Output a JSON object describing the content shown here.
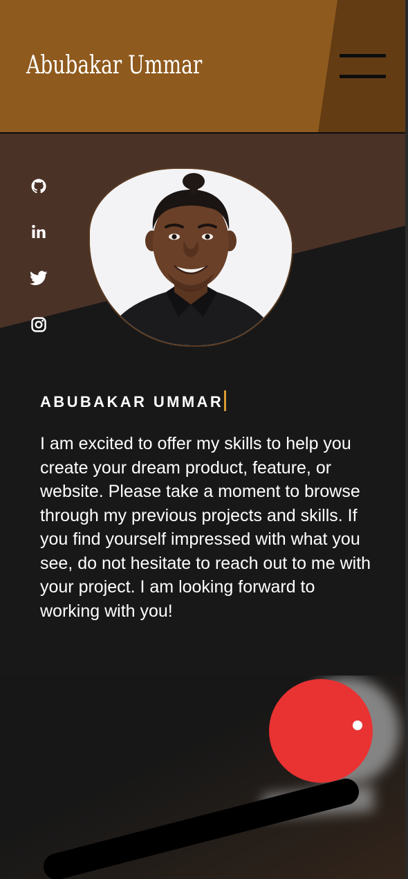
{
  "header": {
    "title": "Abubakar Ummar",
    "menu_icon": "hamburger-menu-icon"
  },
  "social": [
    {
      "name": "github",
      "icon": "github-icon"
    },
    {
      "name": "linkedin",
      "icon": "linkedin-icon"
    },
    {
      "name": "twitter",
      "icon": "twitter-icon"
    },
    {
      "name": "instagram",
      "icon": "instagram-icon"
    }
  ],
  "profile": {
    "name": "ABUBAKAR UMMAR",
    "bio": "I am excited to offer my skills to help you create your dream product, feature, or website. Please take a moment to browse through my previous projects and skills. If you find yourself impressed with what you see, do not hesitate to reach out to me with your project. I am looking forward to working with you!"
  },
  "colors": {
    "header_brown": "#8f5a1e",
    "header_dark_brown": "#643c13",
    "hero_brown": "#4a3227",
    "background": "#181818",
    "accent_cursor": "#d89b33",
    "ball_red": "#e93232"
  }
}
